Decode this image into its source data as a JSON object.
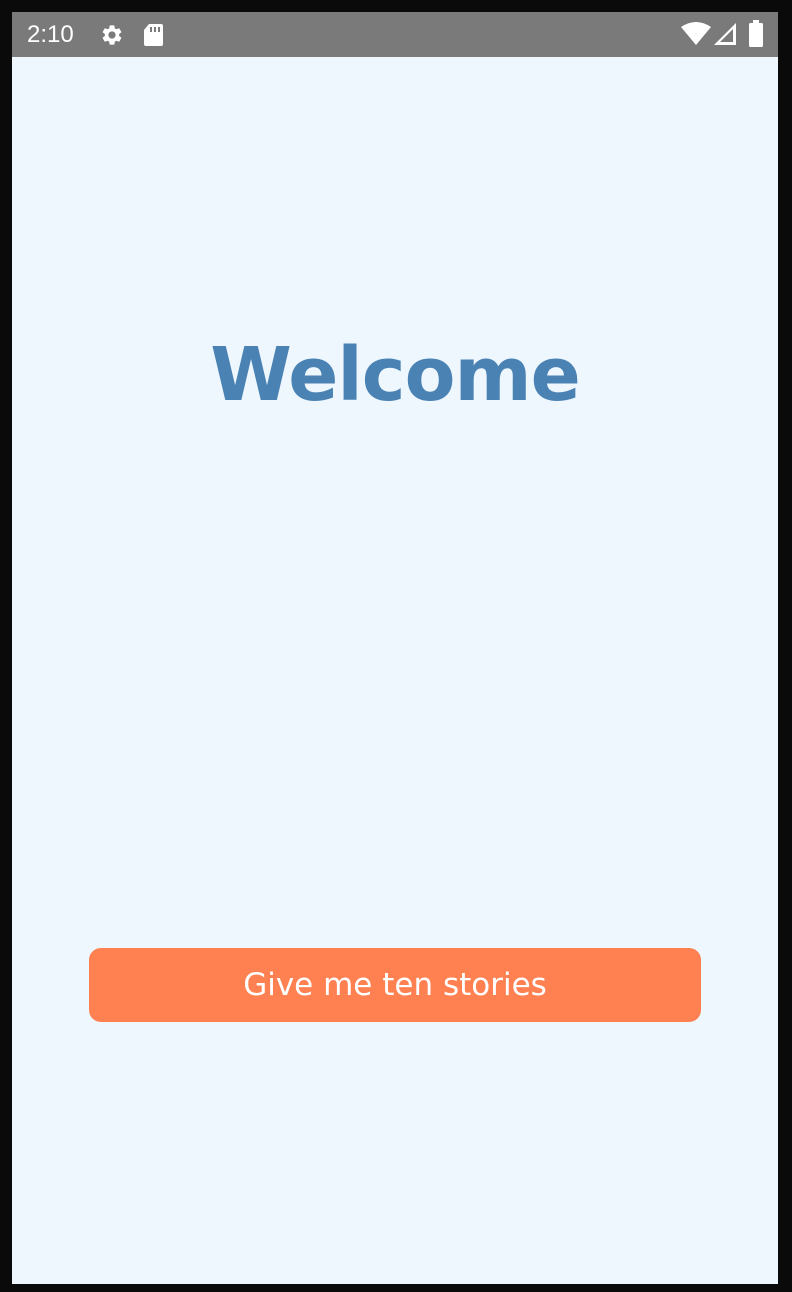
{
  "status_bar": {
    "time": "2:10",
    "left_icons": [
      "gear-icon",
      "sd-card-icon"
    ],
    "right_icons": [
      "wifi-icon",
      "signal-icon",
      "battery-icon"
    ]
  },
  "main": {
    "title": "Welcome",
    "cta_label": "Give me ten stories"
  },
  "colors": {
    "status_bar_bg": "#7a7a7a",
    "screen_bg": "#eef6fe",
    "title": "#4a82b4",
    "button_bg": "#ff8050",
    "button_text": "#ffffff"
  }
}
